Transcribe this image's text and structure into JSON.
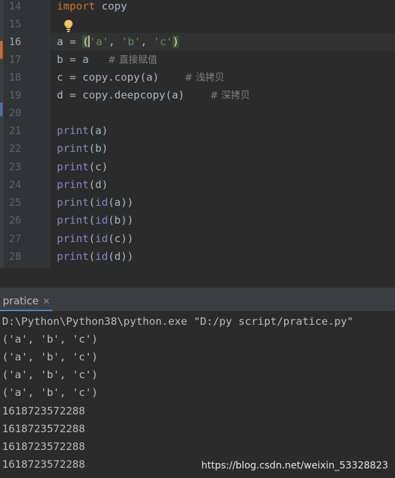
{
  "editor": {
    "line_numbers": [
      "14",
      "15",
      "16",
      "17",
      "18",
      "19",
      "20",
      "21",
      "22",
      "23",
      "24",
      "25",
      "26",
      "27",
      "28"
    ],
    "current_line": "16",
    "code": {
      "l14": {
        "kw": "import",
        "rest": " copy"
      },
      "l16": {
        "pre": "a = ",
        "open": "(",
        "s1": "'a'",
        "c1": ", ",
        "s2": "'b'",
        "c2": ", ",
        "s3": "'c'",
        "close": ")"
      },
      "l17": {
        "code": "b = a   ",
        "comment": "# 直接赋值"
      },
      "l18": {
        "code": "c = copy.copy(a)    ",
        "comment": "# 浅拷贝"
      },
      "l19": {
        "code": "d = copy.deepcopy(a)    ",
        "comment": "# 深拷贝"
      },
      "prints": [
        {
          "fn": "print",
          "arg": "(a)"
        },
        {
          "fn": "print",
          "arg": "(b)"
        },
        {
          "fn": "print",
          "arg": "(c)"
        },
        {
          "fn": "print",
          "arg": "(d)"
        },
        {
          "fn": "print",
          "mid": "(",
          "fn2": "id",
          "arg": "(a))"
        },
        {
          "fn": "print",
          "mid": "(",
          "fn2": "id",
          "arg": "(b))"
        },
        {
          "fn": "print",
          "mid": "(",
          "fn2": "id",
          "arg": "(c))"
        },
        {
          "fn": "print",
          "mid": "(",
          "fn2": "id",
          "arg": "(d))"
        }
      ]
    }
  },
  "run_panel": {
    "tab_label": "pratice",
    "close_glyph": "✕"
  },
  "console": {
    "lines": [
      "D:\\Python\\Python38\\python.exe \"D:/py script/pratice.py\"",
      "('a', 'b', 'c')",
      "('a', 'b', 'c')",
      "('a', 'b', 'c')",
      "('a', 'b', 'c')",
      "1618723572288",
      "1618723572288",
      "1618723572288",
      "1618723572288"
    ]
  },
  "watermark": "https://blog.csdn.net/weixin_53328823",
  "colors": {
    "background": "#2b2b2b",
    "keyword": "#cc7832",
    "builtin": "#8888c6",
    "string": "#6a8759",
    "comment": "#808080",
    "tab_underline": "#4a88c7"
  },
  "icons": [
    "lightbulb-icon",
    "close-icon"
  ]
}
